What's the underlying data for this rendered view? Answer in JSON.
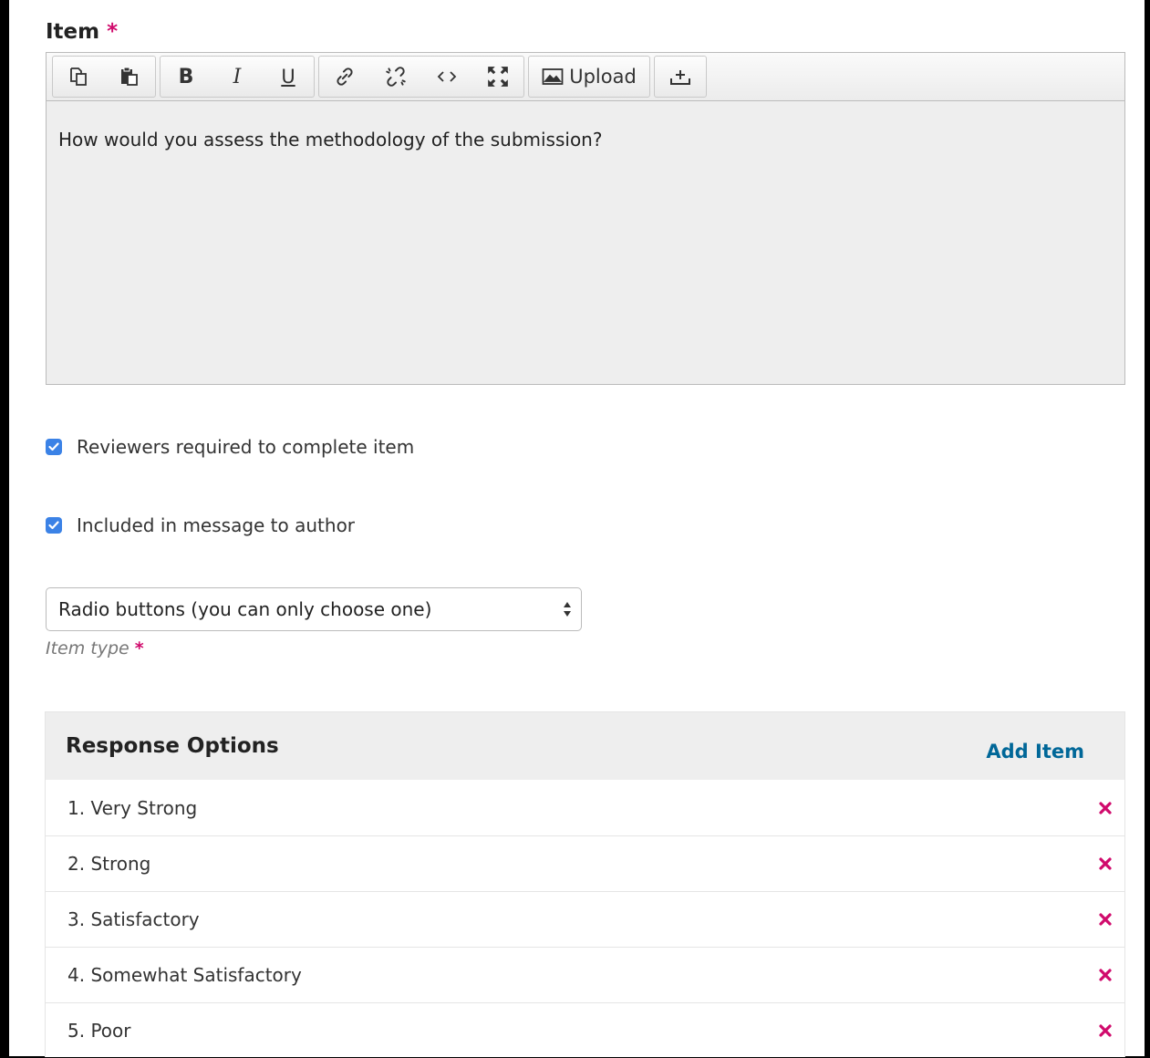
{
  "field": {
    "label": "Item",
    "required_mark": "*",
    "content": "How would you assess the methodology of the submission?"
  },
  "toolbar": {
    "icons": [
      "copy-icon",
      "paste-icon",
      "bold-icon",
      "italic-icon",
      "underline-icon",
      "link-icon",
      "unlink-icon",
      "code-icon",
      "fullscreen-icon",
      "image-icon",
      "upload-icon"
    ],
    "bold_label": "B",
    "italic_label": "I",
    "underline_label": "U",
    "upload_label": "Upload"
  },
  "checkboxes": [
    {
      "label": "Reviewers required to complete item",
      "checked": true
    },
    {
      "label": "Included in message to author",
      "checked": true
    }
  ],
  "item_type": {
    "selected": "Radio buttons (you can only choose one)",
    "label": "Item type",
    "required_mark": "*"
  },
  "response_options": {
    "title": "Response Options",
    "add_label": "Add Item",
    "items": [
      {
        "label": "1. Very Strong"
      },
      {
        "label": "2. Strong"
      },
      {
        "label": "3. Satisfactory"
      },
      {
        "label": "4. Somewhat Satisfactory"
      },
      {
        "label": "5. Poor"
      }
    ]
  },
  "colors": {
    "required": "#d00a6c",
    "link": "#006798",
    "checkbox": "#3b82e6",
    "delete": "#d00a6c",
    "editor_bg": "#eeeeee"
  }
}
